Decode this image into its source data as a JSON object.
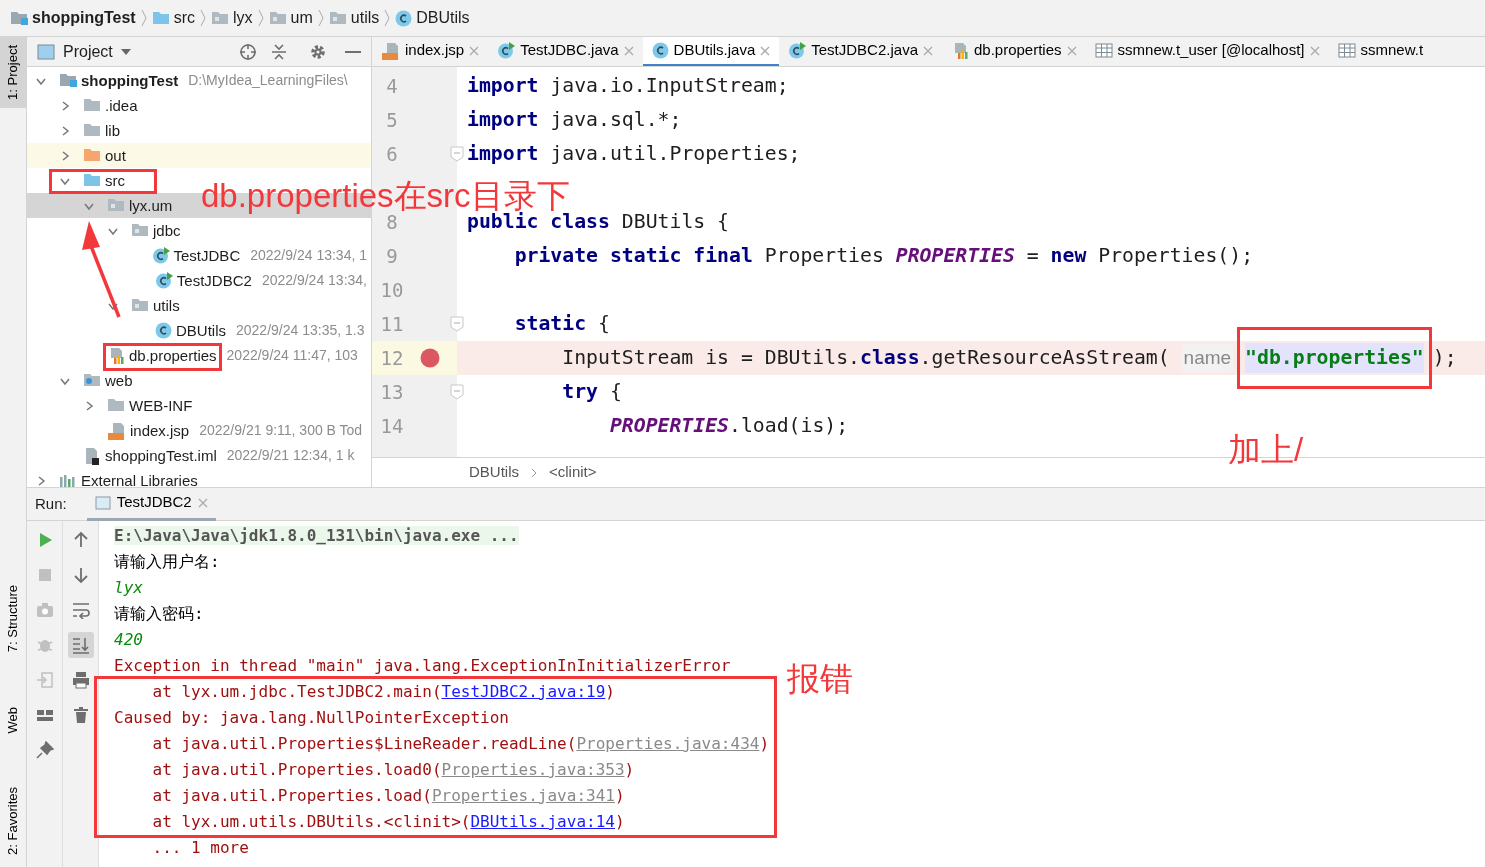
{
  "breadcrumbs": [
    {
      "label": "shoppingTest",
      "kind": "module"
    },
    {
      "label": "src",
      "kind": "source-folder"
    },
    {
      "label": "lyx",
      "kind": "package"
    },
    {
      "label": "um",
      "kind": "package"
    },
    {
      "label": "utils",
      "kind": "package"
    },
    {
      "label": "DBUtils",
      "kind": "class"
    }
  ],
  "left_stripe": {
    "top": [
      {
        "label": "1: Project",
        "selected": true
      }
    ],
    "bottom": [
      {
        "label": "7: Structure",
        "selected": false
      },
      {
        "label": "Web",
        "selected": false
      },
      {
        "label": "2: Favorites",
        "selected": false
      }
    ]
  },
  "project_panel": {
    "title": "Project",
    "tree": [
      {
        "label": "shoppingTest",
        "meta": "D:\\MyIdea_LearningFiles\\",
        "kind": "module",
        "expanded": true,
        "selected": false,
        "children": [
          {
            "label": ".idea",
            "kind": "folder",
            "expanded": false,
            "selected": false
          },
          {
            "label": "lib",
            "kind": "folder",
            "expanded": false,
            "selected": false
          },
          {
            "label": "out",
            "kind": "excluded-folder",
            "expanded": false,
            "selected": false
          },
          {
            "label": "src",
            "kind": "source-folder",
            "expanded": true,
            "selected": false,
            "children": [
              {
                "label": "lyx.um",
                "kind": "package",
                "expanded": true,
                "selected": true,
                "children": [
                  {
                    "label": "jdbc",
                    "kind": "package",
                    "expanded": true,
                    "selected": false,
                    "children": [
                      {
                        "label": "TestJDBC",
                        "meta": "2022/9/24 13:34, 1",
                        "kind": "runnable-class",
                        "selected": false
                      },
                      {
                        "label": "TestJDBC2",
                        "meta": "2022/9/24 13:34,",
                        "kind": "runnable-class",
                        "selected": false
                      }
                    ]
                  },
                  {
                    "label": "utils",
                    "kind": "package",
                    "expanded": true,
                    "selected": false,
                    "children": [
                      {
                        "label": "DBUtils",
                        "meta": "2022/9/24 13:35, 1.3",
                        "kind": "class",
                        "selected": false
                      }
                    ]
                  }
                ]
              },
              {
                "label": "db.properties",
                "meta": "2022/9/24 11:47, 103",
                "kind": "properties",
                "selected": false
              }
            ]
          },
          {
            "label": "web",
            "kind": "web",
            "expanded": true,
            "selected": false,
            "children": [
              {
                "label": "WEB-INF",
                "kind": "folder",
                "expanded": false,
                "selected": false
              },
              {
                "label": "index.jsp",
                "meta": "2022/9/21 9:11, 300 B Tod",
                "kind": "jsp",
                "selected": false
              }
            ]
          },
          {
            "label": "shoppingTest.iml",
            "meta": "2022/9/21 12:34, 1 k",
            "kind": "iml",
            "selected": false
          }
        ]
      },
      {
        "label": "External Libraries",
        "kind": "libraries",
        "expanded": false,
        "selected": false
      }
    ]
  },
  "editor_tabs": [
    {
      "label": "index.jsp",
      "kind": "jsp",
      "selected": false
    },
    {
      "label": "TestJDBC.java",
      "kind": "runnable-class",
      "selected": false
    },
    {
      "label": "DBUtils.java",
      "kind": "class",
      "selected": true
    },
    {
      "label": "TestJDBC2.java",
      "kind": "runnable-class",
      "selected": false
    },
    {
      "label": "db.properties",
      "kind": "properties",
      "selected": false
    },
    {
      "label": "ssmnew.t_user [@localhost]",
      "kind": "table",
      "selected": false
    },
    {
      "label": "ssmnew.t",
      "kind": "table",
      "selected": false
    }
  ],
  "code_lines": [
    {
      "kind": "code",
      "number": "4",
      "tokens": [
        {
          "text": "import",
          "kind": "kw"
        },
        {
          "text": " java.io.InputStream;",
          "kind": "plain"
        }
      ]
    },
    {
      "kind": "code",
      "number": "5",
      "tokens": [
        {
          "text": "import",
          "kind": "kw"
        },
        {
          "text": " java.sql.*;",
          "kind": "plain"
        }
      ]
    },
    {
      "kind": "code",
      "number": "6",
      "fold": true,
      "tokens": [
        {
          "text": "import",
          "kind": "kw"
        },
        {
          "text": " java.util.Properties;",
          "kind": "plain"
        }
      ]
    },
    {
      "kind": "covered"
    },
    {
      "kind": "code",
      "number": "8",
      "tokens": [
        {
          "text": "public class",
          "kind": "kw"
        },
        {
          "text": " DBUtils {",
          "kind": "plain"
        }
      ]
    },
    {
      "kind": "code",
      "number": "9",
      "tokens": [
        {
          "text": "    private static final",
          "kind": "kw"
        },
        {
          "text": " Properties ",
          "kind": "plain"
        },
        {
          "text": "PROPERTIES",
          "kind": "field"
        },
        {
          "text": " = ",
          "kind": "plain"
        },
        {
          "text": "new",
          "kind": "kw"
        },
        {
          "text": " Properties();",
          "kind": "plain"
        }
      ]
    },
    {
      "kind": "code",
      "number": "10"
    },
    {
      "kind": "code",
      "number": "11",
      "fold": true,
      "tokens": [
        {
          "text": "    static",
          "kind": "kw"
        },
        {
          "text": " {",
          "kind": "plain"
        }
      ]
    },
    {
      "kind": "code",
      "number": "12",
      "breakpoint": true,
      "tokens": [
        {
          "text": "        InputStream is = DBUtils.",
          "kind": "plain"
        },
        {
          "text": "class",
          "kind": "kw"
        },
        {
          "text": ".getResourceAsStream( ",
          "kind": "plain"
        },
        {
          "text": "name",
          "kind": "hint"
        },
        {
          "text": "\"db.properties\"",
          "kind": "string"
        },
        {
          "text": ");",
          "kind": "plain"
        }
      ]
    },
    {
      "kind": "code",
      "number": "13",
      "fold": true,
      "tokens": [
        {
          "text": "        try",
          "kind": "kw"
        },
        {
          "text": " {",
          "kind": "plain"
        }
      ]
    },
    {
      "kind": "code",
      "number": "14",
      "tokens": [
        {
          "text": "            PROPERTIES",
          "kind": "field"
        },
        {
          "text": ".load(is);",
          "kind": "plain"
        }
      ]
    }
  ],
  "editor_breadcrumb": [
    "DBUtils",
    "<clinit>"
  ],
  "run_panel": {
    "label": "Run:",
    "tab": "TestJDBC2",
    "lines": [
      {
        "segments": [
          {
            "text": "E:\\Java\\Java\\jdk1.8.0_131\\bin\\java.exe ...",
            "kind": "cmd"
          }
        ]
      },
      {
        "segments": [
          {
            "text": "请输入用户名:",
            "kind": "out"
          }
        ]
      },
      {
        "segments": [
          {
            "text": "lyx",
            "kind": "input"
          }
        ]
      },
      {
        "segments": [
          {
            "text": "请输入密码:",
            "kind": "out"
          }
        ]
      },
      {
        "segments": [
          {
            "text": "420",
            "kind": "input"
          }
        ]
      },
      {
        "segments": [
          {
            "text": "Exception in thread \"main\" java.lang.ExceptionInInitializerError",
            "kind": "err"
          }
        ]
      },
      {
        "segments": [
          {
            "text": "    at lyx.um.jdbc.TestJDBC2.main(",
            "kind": "err"
          },
          {
            "text": "TestJDBC2.java:19",
            "kind": "link"
          },
          {
            "text": ")",
            "kind": "err"
          }
        ]
      },
      {
        "segments": [
          {
            "text": "Caused by: java.lang.NullPointerException",
            "kind": "err"
          }
        ]
      },
      {
        "segments": [
          {
            "text": "    at java.util.Properties$LineReader.readLine(",
            "kind": "err"
          },
          {
            "text": "Properties.java:434",
            "kind": "liblink"
          },
          {
            "text": ")",
            "kind": "err"
          }
        ]
      },
      {
        "segments": [
          {
            "text": "    at java.util.Properties.load0(",
            "kind": "err"
          },
          {
            "text": "Properties.java:353",
            "kind": "liblink"
          },
          {
            "text": ")",
            "kind": "err"
          }
        ]
      },
      {
        "segments": [
          {
            "text": "    at java.util.Properties.load(",
            "kind": "err"
          },
          {
            "text": "Properties.java:341",
            "kind": "liblink"
          },
          {
            "text": ")",
            "kind": "err"
          }
        ]
      },
      {
        "segments": [
          {
            "text": "    at lyx.um.utils.DBUtils.<clinit>(",
            "kind": "err"
          },
          {
            "text": "DBUtils.java:14",
            "kind": "link"
          },
          {
            "text": ")",
            "kind": "err"
          }
        ]
      },
      {
        "segments": [
          {
            "text": "    ... 1 more",
            "kind": "err"
          }
        ]
      }
    ]
  },
  "annotations": [
    {
      "text": "db.properties在src目录下"
    },
    {
      "text": "加上/"
    },
    {
      "text": "报错"
    }
  ]
}
